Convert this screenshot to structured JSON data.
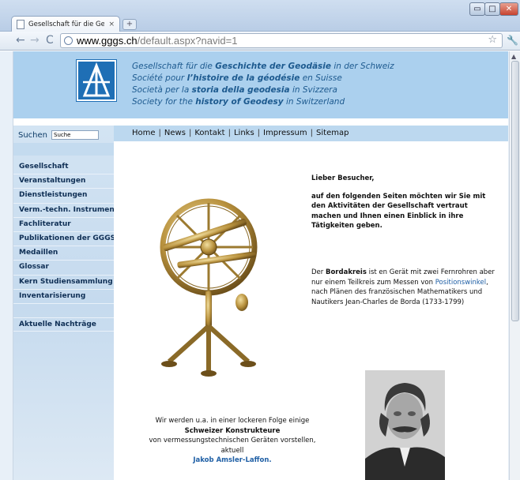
{
  "browser": {
    "tab_title": "Gesellschaft für die Gesc...",
    "tab_close": "×",
    "new_tab": "+",
    "url_host": "www.gggs.ch",
    "url_path": "/default.aspx?navid=1",
    "controls": {
      "minimize": "▭",
      "maximize": "□",
      "close": "✕"
    },
    "nav": {
      "back": "←",
      "forward": "→",
      "reload": "C"
    },
    "star": "☆",
    "wrench": "🔧"
  },
  "banner": {
    "mottos": [
      {
        "pre": "Gesellschaft für die ",
        "bold": "Geschichte der Geodäsie",
        "post": " in der Schweiz"
      },
      {
        "pre": "Société pour ",
        "bold": "l’histoire de la géodésie",
        "post": " en Suisse"
      },
      {
        "pre": "Società per la ",
        "bold": "storia della geodesia",
        "post": " in Svizzera"
      },
      {
        "pre": "Society for the ",
        "bold": "history of Geodesy",
        "post": " in Switzerland"
      }
    ]
  },
  "search": {
    "label": "Suchen",
    "value": "Suche"
  },
  "topnav": [
    "Home",
    "News",
    "Kontakt",
    "Links",
    "Impressum",
    "Sitemap"
  ],
  "sidebar": {
    "items": [
      "Gesellschaft",
      "Veranstaltungen",
      "Dienstleistungen",
      "Verm.-techn. Instrumente",
      "Fachliteratur",
      "Publikationen der GGGS",
      "Medaillen",
      "Glossar",
      "Kern Studiensammlung",
      "Inventarisierung"
    ],
    "extra": "Aktuelle Nachträge"
  },
  "content": {
    "welcome_head": "Lieber Besucher,",
    "welcome_body": "auf den folgenden Seiten möchten wir Sie mit den Aktivitäten der Gesellschaft vertraut machen und Ihnen einen Einblick in ihre Tätigkeiten geben.",
    "borda": {
      "pre": "Der ",
      "bold": "Bordakreis",
      "mid1": " ist en Gerät mit zwei Fernrohren aber nur einem Teilkreis zum Messen von ",
      "link": "Positionswinkel",
      "post": ", nach Plänen des französischen Mathematikers und Nautikers Jean-Charles de Borda (1733-1799)"
    },
    "bottom": {
      "line1": "Wir werden u.a. in einer lockeren Folge einige",
      "line2_bold": "Schweizer Konstrukteure",
      "line3": "von vermessungstechnischen Geräten vorstellen,",
      "line4": "aktuell",
      "person": "Jakob Amsler-Laffon."
    }
  },
  "colors": {
    "banner": "#abd0ee",
    "nav": "#bcd8ef",
    "accent_text": "#1d5a8f",
    "link": "#1f5fa5",
    "logo": "#1f6fb5"
  }
}
